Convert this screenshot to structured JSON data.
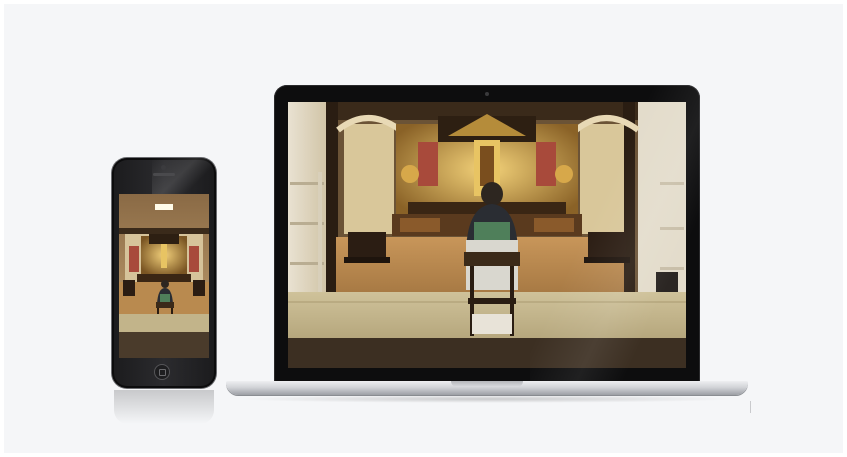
{
  "scene": {
    "description_type": "device mockup",
    "devices": [
      {
        "kind": "smartphone",
        "orientation": "portrait",
        "color": "#1b1b1d"
      },
      {
        "kind": "laptop",
        "color": "#0d0d0e"
      }
    ]
  },
  "colors": {
    "background": "#f5f6f8",
    "altar_gold": "#c9a24a",
    "wood_floor": "#b98a4f",
    "tatami": "#c2b48a",
    "robe_green": "#4f7f5a"
  },
  "icons": {
    "laptop_camera": "camera-dot",
    "phone_camera": "camera-dot",
    "phone_home": "home-button"
  }
}
